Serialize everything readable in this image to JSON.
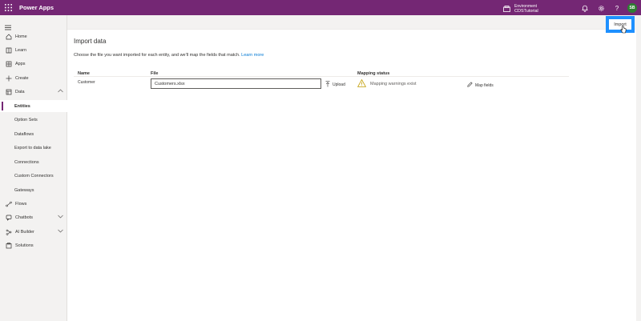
{
  "topbar": {
    "app_title": "Power Apps",
    "environment_label": "Environment",
    "environment_name": "CDSTutorial",
    "avatar_initials": "SB",
    "help_glyph": "?",
    "brand_color": "#742774"
  },
  "sidebar": {
    "items": [
      {
        "label": "Home",
        "icon": "home-icon"
      },
      {
        "label": "Learn",
        "icon": "book-icon"
      },
      {
        "label": "Apps",
        "icon": "apps-icon"
      },
      {
        "label": "Create",
        "icon": "plus-icon"
      },
      {
        "label": "Data",
        "icon": "database-icon"
      },
      {
        "label": "Flows",
        "icon": "flow-icon"
      },
      {
        "label": "Chatbots",
        "icon": "chatbot-icon"
      },
      {
        "label": "AI Builder",
        "icon": "ai-builder-icon"
      },
      {
        "label": "Solutions",
        "icon": "solutions-icon"
      }
    ],
    "data_subitems": [
      "Entities",
      "Option Sets",
      "Dataflows",
      "Export to data lake",
      "Connections",
      "Custom Connectors",
      "Gateways"
    ],
    "active_subitem": "Entities"
  },
  "commandbar": {
    "import_label": "Import"
  },
  "main": {
    "title": "Import data",
    "description": "Choose the file you want imported for each entity, and we'll map the fields that match.",
    "learn_more": "Learn more",
    "columns": {
      "name": "Name",
      "file": "File",
      "mapping_status": "Mapping status"
    },
    "rows": [
      {
        "name": "Customer",
        "file": "Customers.xlsx",
        "upload_label": "Upload",
        "status": "Mapping warnings exist",
        "map_fields_label": "Map fields"
      }
    ]
  }
}
